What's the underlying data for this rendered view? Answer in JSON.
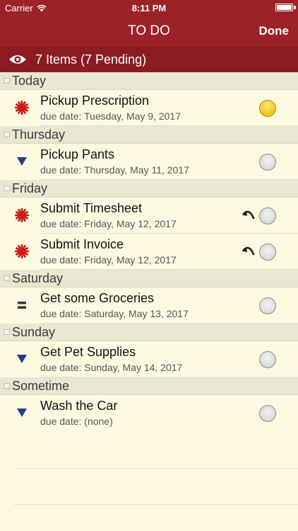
{
  "status": {
    "carrier": "Carrier",
    "time": "8:11 PM"
  },
  "nav": {
    "title": "TO DO",
    "done_label": "Done"
  },
  "summary": {
    "text": "7 Items (7 Pending)"
  },
  "colors": {
    "header": "#9b2328",
    "summary_bar": "#8c1c21",
    "background": "#fefae0",
    "high_priority": "#cc1b1b",
    "low_priority": "#1f3f8f",
    "medium_priority": "#333333",
    "completed_check": "#f5c21a"
  },
  "sections": [
    {
      "label": "Today",
      "items": [
        {
          "title": "Pickup Prescription",
          "due": "due date: Tuesday, May 9, 2017",
          "priority": "high",
          "priority_icon": "asterisk-icon",
          "completed": true,
          "undo": false
        }
      ]
    },
    {
      "label": "Thursday",
      "items": [
        {
          "title": "Pickup Pants",
          "due": "due date: Thursday, May 11, 2017",
          "priority": "low",
          "priority_icon": "triangle-down-icon",
          "completed": false,
          "undo": false
        }
      ]
    },
    {
      "label": "Friday",
      "items": [
        {
          "title": "Submit Timesheet",
          "due": "due date: Friday, May 12, 2017",
          "priority": "high",
          "priority_icon": "asterisk-icon",
          "completed": false,
          "undo": true
        },
        {
          "title": "Submit Invoice",
          "due": "due date: Friday, May 12, 2017",
          "priority": "high",
          "priority_icon": "asterisk-icon",
          "completed": false,
          "undo": true
        }
      ]
    },
    {
      "label": "Saturday",
      "items": [
        {
          "title": "Get some Groceries",
          "due": "due date: Saturday, May 13, 2017",
          "priority": "medium",
          "priority_icon": "equals-icon",
          "completed": false,
          "undo": false
        }
      ]
    },
    {
      "label": "Sunday",
      "items": [
        {
          "title": "Get Pet Supplies",
          "due": "due date: Sunday, May 14, 2017",
          "priority": "low",
          "priority_icon": "triangle-down-icon",
          "completed": false,
          "undo": false
        }
      ]
    },
    {
      "label": "Sometime",
      "items": [
        {
          "title": "Wash the Car",
          "due": "due date: (none)",
          "priority": "low",
          "priority_icon": "triangle-down-icon",
          "completed": false,
          "undo": false
        }
      ]
    }
  ]
}
